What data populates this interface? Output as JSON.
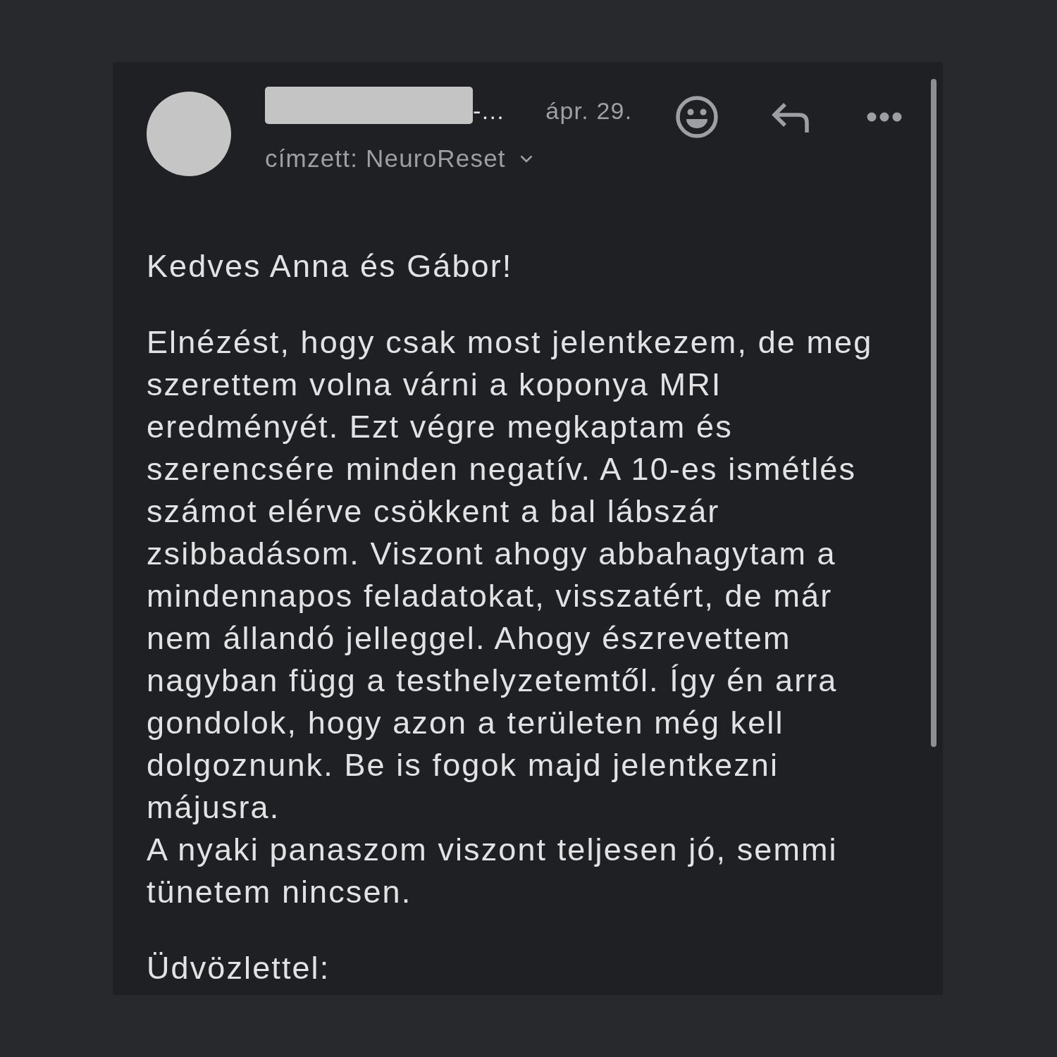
{
  "message": {
    "sender": {
      "tail": "-…"
    },
    "date": "ápr. 29.",
    "recipient": "címzett: NeuroReset",
    "body": [
      {
        "lines": [
          "Kedves Anna és Gábor!"
        ]
      },
      {
        "lines": [
          "Elnézést, hogy csak most jelentkezem, de meg szerettem volna várni a koponya MRI eredményét. Ezt végre megkaptam és szerencsére minden negatív. A 10-es ismétlés számot elérve csökkent a bal lábszár zsibbadásom. Viszont ahogy abbahagytam a mindennapos feladatokat, visszatért, de már nem állandó jelleggel. Ahogy észrevettem nagyban függ a testhelyzetemtől. Így én arra gondolok, hogy azon a területen még kell dolgoznunk. Be is fogok majd jelentkezni májusra.",
          "A nyaki panaszom viszont teljesen jó, semmi tünetem nincsen."
        ]
      },
      {
        "lines": [
          "Üdvözlettel:"
        ]
      }
    ]
  }
}
